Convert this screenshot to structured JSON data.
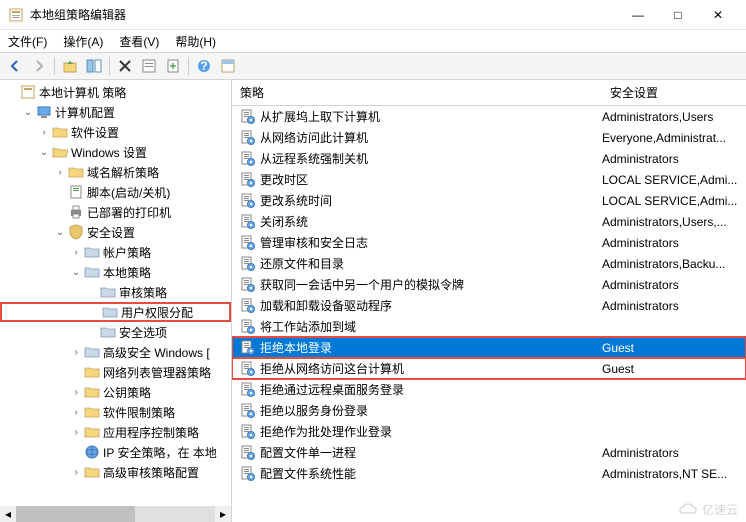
{
  "window": {
    "title": "本地组策略编辑器",
    "min": "—",
    "max": "□",
    "close": "✕"
  },
  "menu": {
    "file": "文件(F)",
    "action": "操作(A)",
    "view": "查看(V)",
    "help": "帮助(H)"
  },
  "tree": {
    "root": "本地计算机 策略",
    "computer_config": "计算机配置",
    "software_settings": "软件设置",
    "windows_settings": "Windows 设置",
    "dns_policy": "域名解析策略",
    "scripts": "脚本(启动/关机)",
    "deployed_printers": "已部署的打印机",
    "security_settings": "安全设置",
    "account_policies": "帐户策略",
    "local_policies": "本地策略",
    "audit_policy": "审核策略",
    "user_rights": "用户权限分配",
    "security_options": "安全选项",
    "advanced_windows": "高级安全 Windows [",
    "network_list": "网络列表管理器策略",
    "public_key": "公钥策略",
    "software_restriction": "软件限制策略",
    "app_control": "应用程序控制策略",
    "ip_security": "IP 安全策略，在 本地",
    "advanced_audit": "高级审核策略配置"
  },
  "columns": {
    "policy": "策略",
    "security": "安全设置"
  },
  "policies": [
    {
      "name": "从扩展坞上取下计算机",
      "setting": "Administrators,Users"
    },
    {
      "name": "从网络访问此计算机",
      "setting": "Everyone,Administrat..."
    },
    {
      "name": "从远程系统强制关机",
      "setting": "Administrators"
    },
    {
      "name": "更改时区",
      "setting": "LOCAL SERVICE,Admi..."
    },
    {
      "name": "更改系统时间",
      "setting": "LOCAL SERVICE,Admi..."
    },
    {
      "name": "关闭系统",
      "setting": "Administrators,Users,..."
    },
    {
      "name": "管理审核和安全日志",
      "setting": "Administrators"
    },
    {
      "name": "还原文件和目录",
      "setting": "Administrators,Backu..."
    },
    {
      "name": "获取同一会话中另一个用户的模拟令牌",
      "setting": "Administrators"
    },
    {
      "name": "加载和卸载设备驱动程序",
      "setting": "Administrators"
    },
    {
      "name": "将工作站添加到域",
      "setting": ""
    },
    {
      "name": "拒绝本地登录",
      "setting": "Guest"
    },
    {
      "name": "拒绝从网络访问这台计算机",
      "setting": "Guest"
    },
    {
      "name": "拒绝通过远程桌面服务登录",
      "setting": ""
    },
    {
      "name": "拒绝以服务身份登录",
      "setting": ""
    },
    {
      "name": "拒绝作为批处理作业登录",
      "setting": ""
    },
    {
      "name": "配置文件单一进程",
      "setting": "Administrators"
    },
    {
      "name": "配置文件系统性能",
      "setting": "Administrators,NT SE..."
    }
  ],
  "watermark": "亿速云"
}
